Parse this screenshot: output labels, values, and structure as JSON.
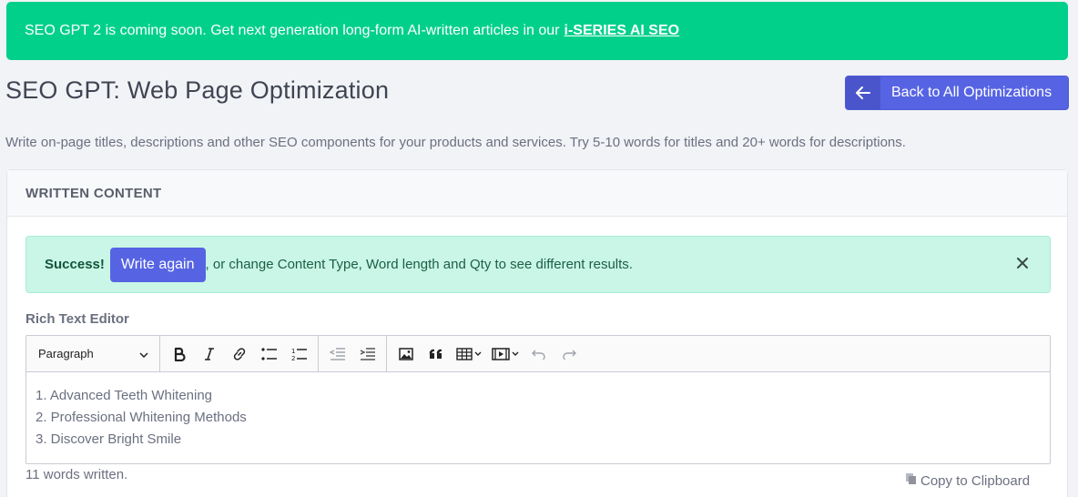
{
  "banner": {
    "text": "SEO GPT 2 is coming soon. Get next generation long-form AI-written articles in our",
    "link_text": "i-SERIES AI SEO"
  },
  "header": {
    "title": "SEO GPT: Web Page Optimization",
    "back_button": "Back to All Optimizations"
  },
  "subtitle": "Write on-page titles, descriptions and other SEO components for your products and services. Try 5-10 words for titles and 20+ words for descriptions.",
  "card": {
    "title": "WRITTEN CONTENT",
    "alert": {
      "strong": "Success!",
      "button": "Write again",
      "message": ", or change Content Type, Word length and Qty to see different results."
    },
    "editor": {
      "label": "Rich Text Editor",
      "block_format": "Paragraph",
      "lines": [
        "1. Advanced Teeth Whitening",
        "2. Professional Whitening Methods",
        "3. Discover Bright Smile"
      ]
    },
    "word_count": "11 words written.",
    "copy_button": "Copy to Clipboard"
  },
  "colors": {
    "banner": "#00d08a",
    "primary": "#5664e3",
    "alert_bg": "#c9f6e6"
  }
}
